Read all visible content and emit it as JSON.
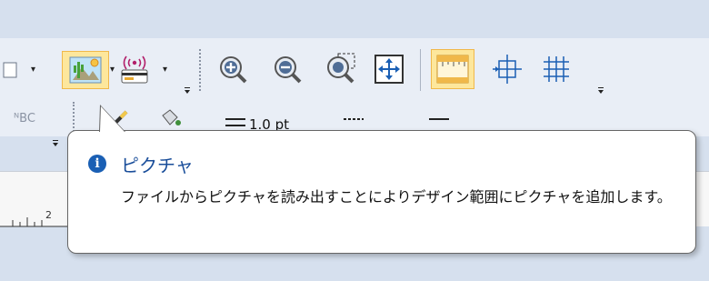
{
  "toolbar": {
    "row2": {
      "text_style_partial": "ᴺBC",
      "font_size_value": "1.0 pt"
    }
  },
  "tooltip": {
    "icon": "info-icon",
    "title": "ピクチャ",
    "body": "ファイルからピクチャを読み出すことによりデザイン範囲にピクチャを追加します。"
  },
  "ruler": {
    "label": "2"
  },
  "colors": {
    "accent": "#1a5fb4",
    "highlight": "#fde79c",
    "toolbar_bg": "#e9eef6"
  }
}
